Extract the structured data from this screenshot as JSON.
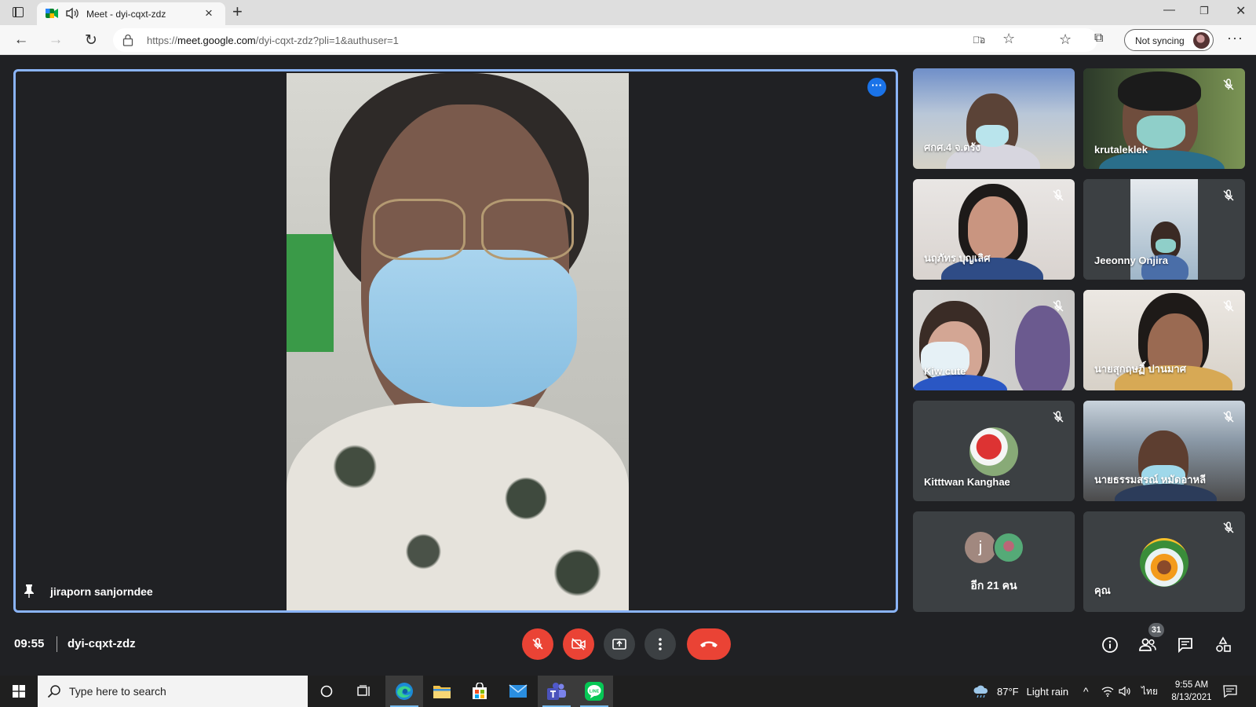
{
  "browser": {
    "tab_title": "Meet - dyi-cqxt-zdz",
    "url_prefix": "https://",
    "url_host": "meet.google.com",
    "url_path": "/dyi-cqxt-zdz?pli=1&authuser=1",
    "sync_label": "Not syncing",
    "read_aloud": "อ̈อ"
  },
  "meet": {
    "main_participant": "jiraporn sanjorndee",
    "clock": "09:55",
    "meeting_code": "dyi-cqxt-zdz",
    "participant_count": "31",
    "accent_color": "#8ab4f8",
    "danger_color": "#ea4335"
  },
  "tiles": [
    {
      "name": "ศกศ.4 จ.ตรัง",
      "muted": false
    },
    {
      "name": "krutaleklek",
      "muted": true
    },
    {
      "name": "นฤภัทร บุญเลิศ",
      "muted": true
    },
    {
      "name": "Jeeonny Onjira",
      "muted": true
    },
    {
      "name": "Kiw cute",
      "muted": true
    },
    {
      "name": "นายสุกฤษฏิ์ ปานมาศ",
      "muted": true
    },
    {
      "name": "Kitttwan Kanghae",
      "muted": true
    },
    {
      "name": "นายธรรมสรณ์ หมัดอาหลี",
      "muted": true
    },
    {
      "name": "อีก 21 คน",
      "initial": "j"
    },
    {
      "name": "คุณ",
      "muted": true
    }
  ],
  "taskbar": {
    "search_placeholder": "Type here to search",
    "weather_temp": "87°F",
    "weather_text": "Light rain",
    "lang": "ไทย",
    "time": "9:55 AM",
    "date": "8/13/2021"
  }
}
